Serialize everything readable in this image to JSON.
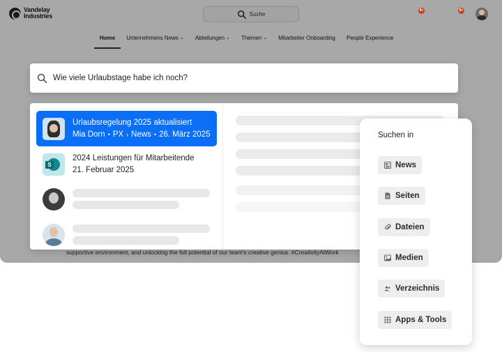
{
  "brand": {
    "name_line1": "Vandelay",
    "name_line2": "Industries"
  },
  "top_search": {
    "placeholder": "Suche"
  },
  "notifications": [
    "9+",
    "9+"
  ],
  "nav": {
    "items": [
      {
        "label": "Home",
        "active": true,
        "dropdown": false
      },
      {
        "label": "Unternehmens News",
        "dropdown": true
      },
      {
        "label": "Abteilungen",
        "dropdown": true
      },
      {
        "label": "Themen",
        "dropdown": true
      },
      {
        "label": "Mitarbeiter Onboarding",
        "dropdown": false
      },
      {
        "label": "People Experience",
        "dropdown": false
      }
    ]
  },
  "background_text": "supportive environment, and unlocking the full potential of our team's creative genius. #CreativityAtWork",
  "search": {
    "query": "Wie viele Urlaubstage habe ich noch?"
  },
  "results": [
    {
      "title": "Urlaubsregelung 2025 aktualisiert",
      "author": "Mia Dorn",
      "dept": "PX",
      "section": "News",
      "date": "26. März 2025",
      "selected": true
    },
    {
      "title": "2024 Leistungen für Mitarbeitende",
      "date": "21. Februar 2025",
      "selected": false
    }
  ],
  "search_in": {
    "title": "Suchen in",
    "options": [
      {
        "label": "News",
        "icon": "news-icon"
      },
      {
        "label": "Seiten",
        "icon": "page-icon"
      },
      {
        "label": "Dateien",
        "icon": "paperclip-icon"
      },
      {
        "label": "Medien",
        "icon": "image-icon"
      },
      {
        "label": "Verzeichnis",
        "icon": "people-icon"
      },
      {
        "label": "Apps & Tools",
        "icon": "grid-icon"
      }
    ]
  },
  "colors": {
    "accent": "#0b6ef6",
    "notification": "#c8411d"
  }
}
